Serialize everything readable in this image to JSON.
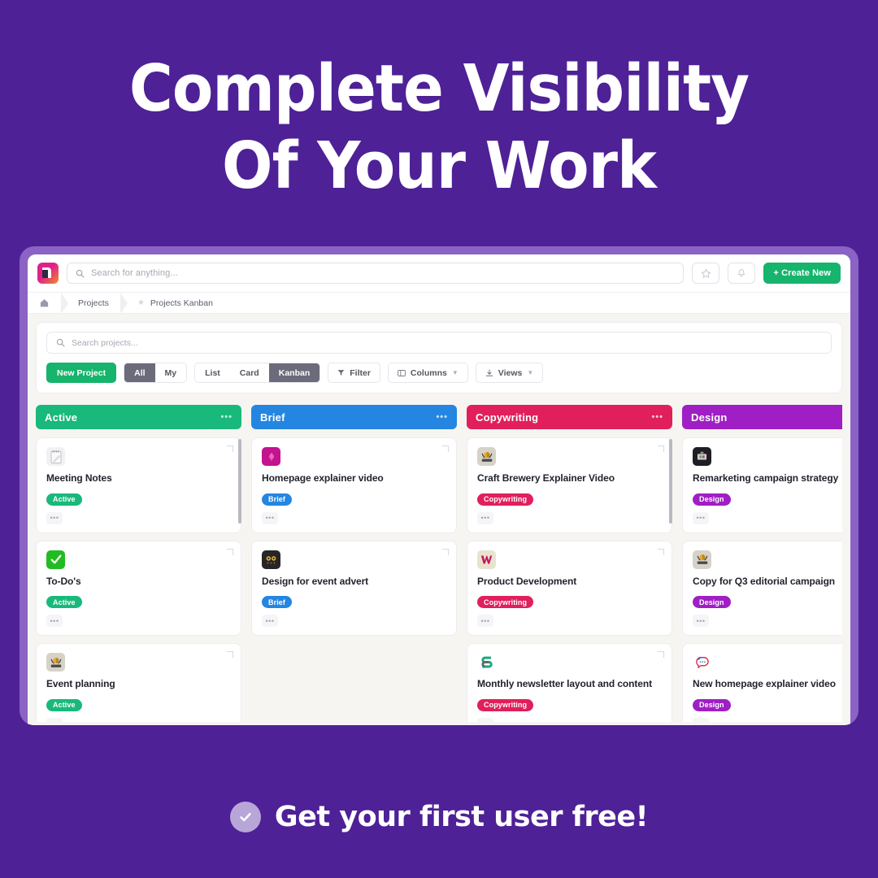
{
  "promo": {
    "headline_line1": "Complete Visibility",
    "headline_line2": "Of Your Work",
    "cta_text": "Get your first user free!",
    "cta_icon": "check-circle-icon",
    "background_color": "#4e2196",
    "frame_color": "#8a63c4"
  },
  "appbar": {
    "logo_name": "app-logo",
    "search_placeholder": "Search for anything...",
    "search_value": "",
    "favorites_icon": "star-icon",
    "notifications_icon": "bell-icon",
    "create_label": "+ Create New",
    "create_color": "#16b46c"
  },
  "breadcrumb": {
    "home_icon": "home-icon",
    "items": [
      {
        "label": "Projects",
        "icon": ""
      },
      {
        "label": "Projects Kanban",
        "icon": "star-icon"
      }
    ]
  },
  "toolbar": {
    "search_placeholder": "Search projects...",
    "search_value": "",
    "new_project_label": "New Project",
    "scope": {
      "options": [
        "All",
        "My"
      ],
      "selected": "All"
    },
    "view_modes": {
      "options": [
        "List",
        "Card",
        "Kanban"
      ],
      "selected": "Kanban"
    },
    "filter_label": "Filter",
    "filter_icon": "funnel-icon",
    "columns_label": "Columns",
    "columns_icon": "columns-icon",
    "views_label": "Views",
    "views_icon": "download-icon",
    "chevron_icon": "chevron-down-icon"
  },
  "board": {
    "menu_glyph": "•••",
    "columns": [
      {
        "title": "Active",
        "color": "#18b97a",
        "tag_color": "#18b97a",
        "scroll": {
          "top": 0,
          "height": 100,
          "visible": true
        },
        "cards": [
          {
            "title": "Meeting Notes",
            "tag": "Active",
            "icon": "notepad-icon"
          },
          {
            "title": "To-Do's",
            "tag": "Active",
            "icon": "check-mark-icon"
          },
          {
            "title": "Event planning",
            "tag": "Active",
            "icon": "brewery-logo-icon"
          }
        ]
      },
      {
        "title": "Brief",
        "color": "#2486e0",
        "tag_color": "#2486e0",
        "scroll": {
          "top": 0,
          "height": 0,
          "visible": false
        },
        "cards": [
          {
            "title": "Homepage explainer video",
            "tag": "Brief",
            "icon": "magenta-badge-icon"
          },
          {
            "title": "Design for event advert",
            "tag": "Brief",
            "icon": "owl-logo-icon"
          }
        ]
      },
      {
        "title": "Copywriting",
        "color": "#e01f5c",
        "tag_color": "#e01f5c",
        "scroll": {
          "top": 0,
          "height": 100,
          "visible": true
        },
        "cards": [
          {
            "title": "Craft Brewery Explainer Video",
            "tag": "Copywriting",
            "icon": "brewery-logo-icon"
          },
          {
            "title": "Product Development",
            "tag": "Copywriting",
            "icon": "w-logo-icon"
          },
          {
            "title": "Monthly newsletter layout and content",
            "tag": "Copywriting",
            "icon": "teal-s-logo-icon"
          }
        ]
      },
      {
        "title": "Design",
        "color": "#9f1fc4",
        "tag_color": "#9f1fc4",
        "scroll": {
          "top": 0,
          "height": 0,
          "visible": false
        },
        "cards": [
          {
            "title": "Remarketing campaign strategy",
            "tag": "Design",
            "icon": "dark-badge-icon"
          },
          {
            "title": "Copy for Q3 editorial campaign",
            "tag": "Design",
            "icon": "brewery-logo-icon"
          },
          {
            "title": "New homepage explainer video",
            "tag": "Design",
            "icon": "speech-bubble-icon"
          }
        ]
      }
    ]
  }
}
